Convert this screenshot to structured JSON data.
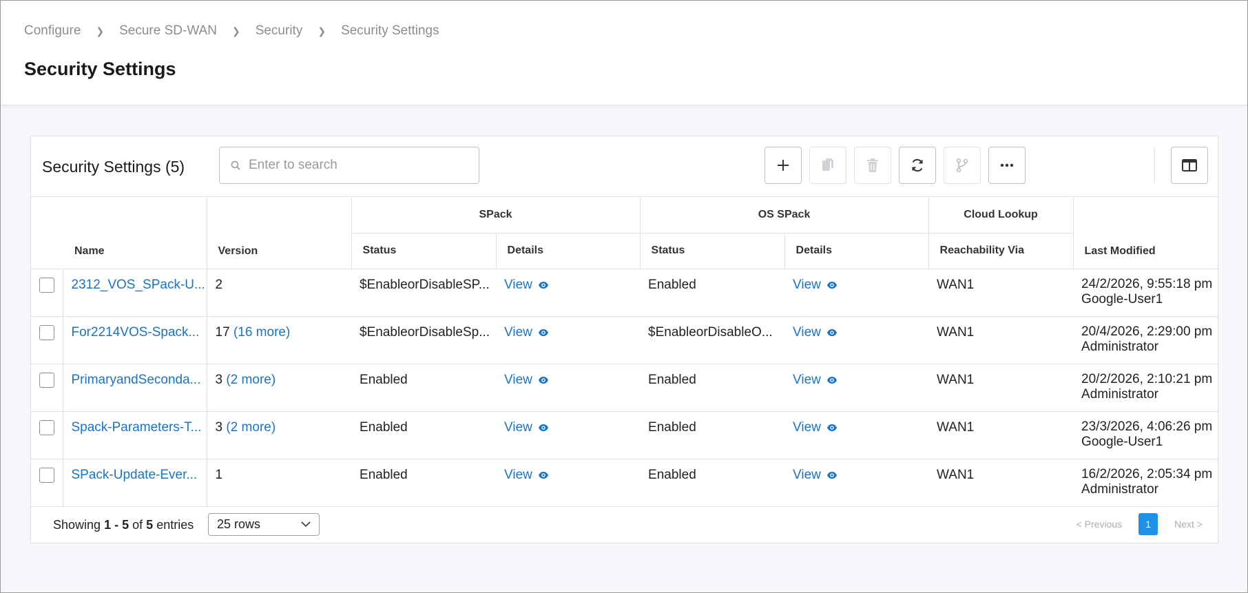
{
  "breadcrumb": [
    "Configure",
    "Secure SD-WAN",
    "Security",
    "Security Settings"
  ],
  "page_title": "Security Settings",
  "card": {
    "title": "Security Settings (5)",
    "search_placeholder": "Enter to search"
  },
  "toolbar_icons": [
    "plus-icon",
    "copy-icon",
    "trash-icon",
    "refresh-icon",
    "branch-icon",
    "more-icon",
    "columns-icon"
  ],
  "table": {
    "group_headers": {
      "spack": "SPack",
      "os_spack": "OS SPack",
      "cloud_lookup": "Cloud Lookup"
    },
    "columns": {
      "name": "Name",
      "version": "Version",
      "spack_status": "Status",
      "spack_details": "Details",
      "os_status": "Status",
      "os_details": "Details",
      "reachability": "Reachability Via",
      "last_modified": "Last Modified"
    },
    "rows": [
      {
        "name": "2312_VOS_SPack-U...",
        "version": "2",
        "version_more": "",
        "spack_status": "$EnableorDisableSP...",
        "spack_details": "View",
        "os_status": "Enabled",
        "os_details": "View",
        "reachability": "WAN1",
        "modified": "24/2/2026, 9:55:18 pm",
        "modified_by": "Google-User1"
      },
      {
        "name": "For2214VOS-Spack...",
        "version": "17",
        "version_more": "(16 more)",
        "spack_status": "$EnableorDisableSp...",
        "spack_details": "View",
        "os_status": "$EnableorDisableO...",
        "os_details": "View",
        "reachability": "WAN1",
        "modified": "20/4/2026, 2:29:00 pm",
        "modified_by": "Administrator"
      },
      {
        "name": "PrimaryandSeconda...",
        "version": "3",
        "version_more": "(2 more)",
        "spack_status": "Enabled",
        "spack_details": "View",
        "os_status": "Enabled",
        "os_details": "View",
        "reachability": "WAN1",
        "modified": "20/2/2026, 2:10:21 pm",
        "modified_by": "Administrator"
      },
      {
        "name": "Spack-Parameters-T...",
        "version": "3",
        "version_more": "(2 more)",
        "spack_status": "Enabled",
        "spack_details": "View",
        "os_status": "Enabled",
        "os_details": "View",
        "reachability": "WAN1",
        "modified": "23/3/2026, 4:06:26 pm",
        "modified_by": "Google-User1"
      },
      {
        "name": "SPack-Update-Ever...",
        "version": "1",
        "version_more": "",
        "spack_status": "Enabled",
        "spack_details": "View",
        "os_status": "Enabled",
        "os_details": "View",
        "reachability": "WAN1",
        "modified": "16/2/2026, 2:05:34 pm",
        "modified_by": "Administrator"
      }
    ]
  },
  "footer": {
    "showing_prefix": "Showing",
    "range_start": "1",
    "range_sep": "-",
    "range_end": "5",
    "of": "of",
    "total": "5",
    "entries": "entries",
    "rows_select": "25 rows",
    "prev": "< Previous",
    "page": "1",
    "next": "Next >"
  },
  "colors": {
    "link": "#1a73c7",
    "active_page": "#1e90e6",
    "border": "#dde1e6"
  }
}
